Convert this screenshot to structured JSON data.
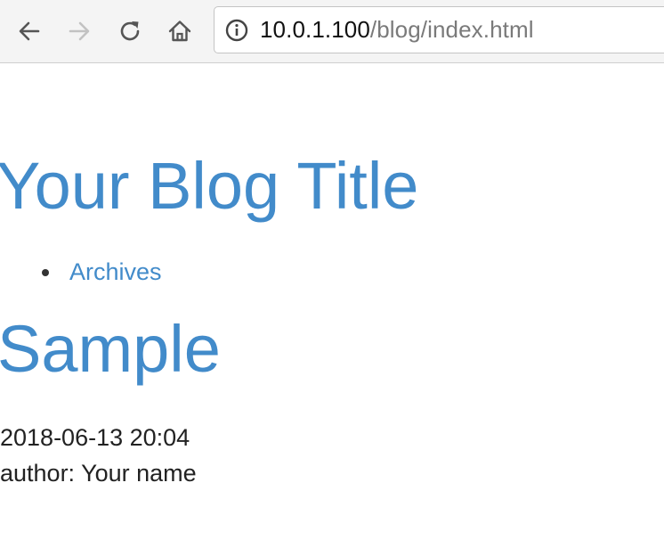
{
  "browser": {
    "url_host": "10.0.1.100",
    "url_path": "/blog/index.html",
    "icons": {
      "back": "arrow-left-icon",
      "forward": "arrow-right-icon",
      "reload": "reload-icon",
      "home": "home-icon",
      "site_info": "info-circle-icon"
    },
    "forward_disabled": true
  },
  "blog": {
    "title": "Your Blog Title",
    "nav": [
      {
        "label": "Archives"
      }
    ]
  },
  "post": {
    "title": "Sample",
    "date": "2018-06-13 20:04",
    "author": "author: Your name"
  },
  "colors": {
    "link": "#428bca",
    "text": "#222222",
    "toolbar_bg": "#f4f4f4"
  }
}
